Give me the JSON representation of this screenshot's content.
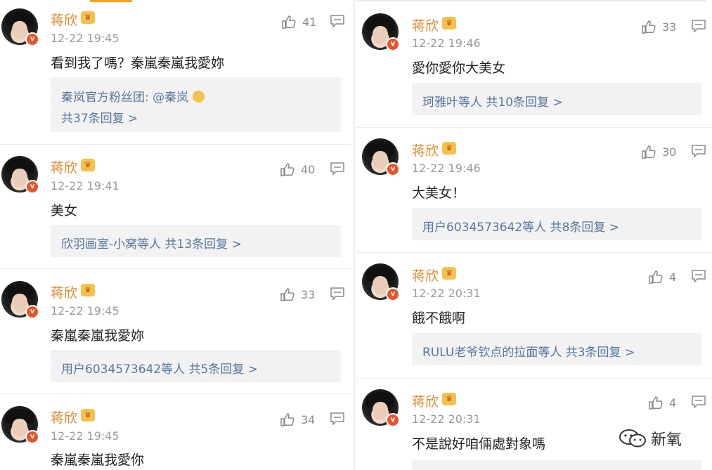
{
  "left_comments": [
    {
      "name": "蒋欣",
      "time": "12-22 19:45",
      "likes": "41",
      "text": "看到我了嗎？秦嵐秦嵐我愛妳",
      "reply_line1": "秦岚官方粉丝团: @秦岚",
      "reply_line2": "共37条回复 >"
    },
    {
      "name": "蒋欣",
      "time": "12-22 19:41",
      "likes": "40",
      "text": "美女",
      "reply_line1": "欣羽画室-小窝等人  共13条回复 >"
    },
    {
      "name": "蒋欣",
      "time": "12-22 19:45",
      "likes": "33",
      "text": "秦嵐秦嵐我愛妳",
      "reply_line1": "用户6034573642等人  共5条回复 >"
    },
    {
      "name": "蒋欣",
      "time": "12-22 19:45",
      "likes": "34",
      "text": "秦嵐秦嵐我愛你"
    }
  ],
  "right_comments": [
    {
      "name": "蒋欣",
      "time": "12-22 19:46",
      "likes": "33",
      "text": "愛你愛你大美女",
      "reply_line1": "珂雅叶等人  共10条回复 >"
    },
    {
      "name": "蒋欣",
      "time": "12-22 19:46",
      "likes": "30",
      "text": "大美女！",
      "reply_line1": "用户6034573642等人  共8条回复 >"
    },
    {
      "name": "蒋欣",
      "time": "12-22 20:31",
      "likes": "4",
      "text": "餓不餓啊",
      "reply_line1": "RULU老爷钦点的拉面等人  共3条回复 >"
    },
    {
      "name": "蒋欣",
      "time": "12-22 20:31",
      "likes": "4",
      "text": "不是說好咱倆處對象嗎"
    }
  ],
  "watermark": "新氧",
  "colors": {
    "name": "#e58a2e",
    "reply_link": "#5577a0",
    "badge": "#e8542a"
  },
  "icons": {
    "like": "thumbs-up-icon",
    "reply": "comment-icon",
    "verified": "verified-badge-icon",
    "crown": "vip-crown-icon"
  }
}
